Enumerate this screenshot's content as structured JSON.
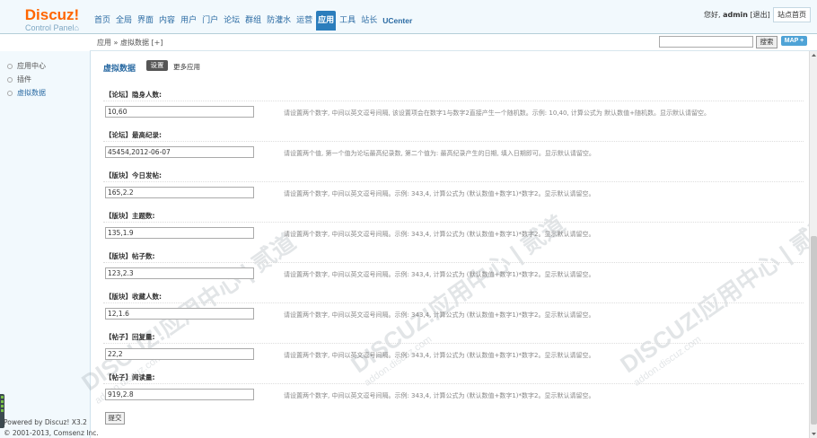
{
  "header": {
    "brand": "Discuz!",
    "subtitle": "Control Panel",
    "nav": [
      {
        "label": "首页"
      },
      {
        "label": "全局"
      },
      {
        "label": "界面"
      },
      {
        "label": "内容"
      },
      {
        "label": "用户"
      },
      {
        "label": "门户"
      },
      {
        "label": "论坛"
      },
      {
        "label": "群组"
      },
      {
        "label": "防灌水"
      },
      {
        "label": "运营"
      },
      {
        "label": "应用",
        "active": true
      },
      {
        "label": "工具"
      },
      {
        "label": "站长"
      },
      {
        "label": "UCenter"
      }
    ],
    "greeting": "您好,",
    "username": "admin",
    "logout": "[退出]",
    "site_home": "站点首页"
  },
  "crumbbar": {
    "breadcrumb": "应用 » 虚拟数据  [+]",
    "search_value": "",
    "search_button": "搜索",
    "map_button": "MAP"
  },
  "sidebar": {
    "items": [
      {
        "label": "应用中心"
      },
      {
        "label": "插件"
      },
      {
        "label": "虚拟数据",
        "active": true
      }
    ],
    "powered": "Powered by Discuz! X3.2",
    "copyright": "© 2001-2013, Comsenz Inc."
  },
  "main": {
    "title": "虚拟数据",
    "tab_settings": "设置",
    "tab_more": "更多应用",
    "rows": [
      {
        "label": "【论坛】隐身人数:",
        "value": "10,60",
        "hint": "请设置两个数字, 中间以英文逗号间隔, 该设置项会在数字1与数字2直接产生一个随机数。示例: 10,40, 计算公式为 默认数值+随机数。显示默认请留空。"
      },
      {
        "label": "【论坛】最高纪录:",
        "value": "45454,2012-06-07",
        "hint": "请设置两个值, 第一个值为论坛最高纪录数, 第二个值为: 最高纪录产生的日期, 填入日期即可。显示默认请留空。"
      },
      {
        "label": "【版块】今日发帖:",
        "value": "165,2.2",
        "hint": "请设置两个数字, 中间以英文逗号间隔。示例: 343,4, 计算公式为 (默认数值+数字1)*数字2。显示默认请留空。"
      },
      {
        "label": "【版块】主题数:",
        "value": "135,1.9",
        "hint": "请设置两个数字, 中间以英文逗号间隔。示例: 343,4, 计算公式为 (默认数值+数字1)*数字2。显示默认请留空。"
      },
      {
        "label": "【版块】帖子数:",
        "value": "123,2.3",
        "hint": "请设置两个数字, 中间以英文逗号间隔。示例: 343,4, 计算公式为 (默认数值+数字1)*数字2。显示默认请留空。"
      },
      {
        "label": "【版块】收藏人数:",
        "value": "12,1.6",
        "hint": "请设置两个数字, 中间以英文逗号间隔。示例: 343,4, 计算公式为 (默认数值+数字1)*数字2。显示默认请留空。"
      },
      {
        "label": "【帖子】回复量:",
        "value": "22,2",
        "hint": "请设置两个数字, 中间以英文逗号间隔。示例: 343,4, 计算公式为 (默认数值+数字1)*数字2。显示默认请留空。"
      },
      {
        "label": "【帖子】阅读量:",
        "value": "919,2.8",
        "hint": "请设置两个数字, 中间以英文逗号间隔。示例: 343,4, 计算公式为 (默认数值+数字1)*数字2。显示默认请留空。"
      }
    ],
    "submit_label": "提交"
  },
  "watermark": {
    "text": "DISCUZ!应用中心 | 贰道",
    "sub": "addon.discuz.com"
  },
  "colors": {
    "accent": "#2b7dbc",
    "brand": "#ff6600",
    "sidebar_bg": "#f2f9fd",
    "link": "#2b6ba3"
  }
}
